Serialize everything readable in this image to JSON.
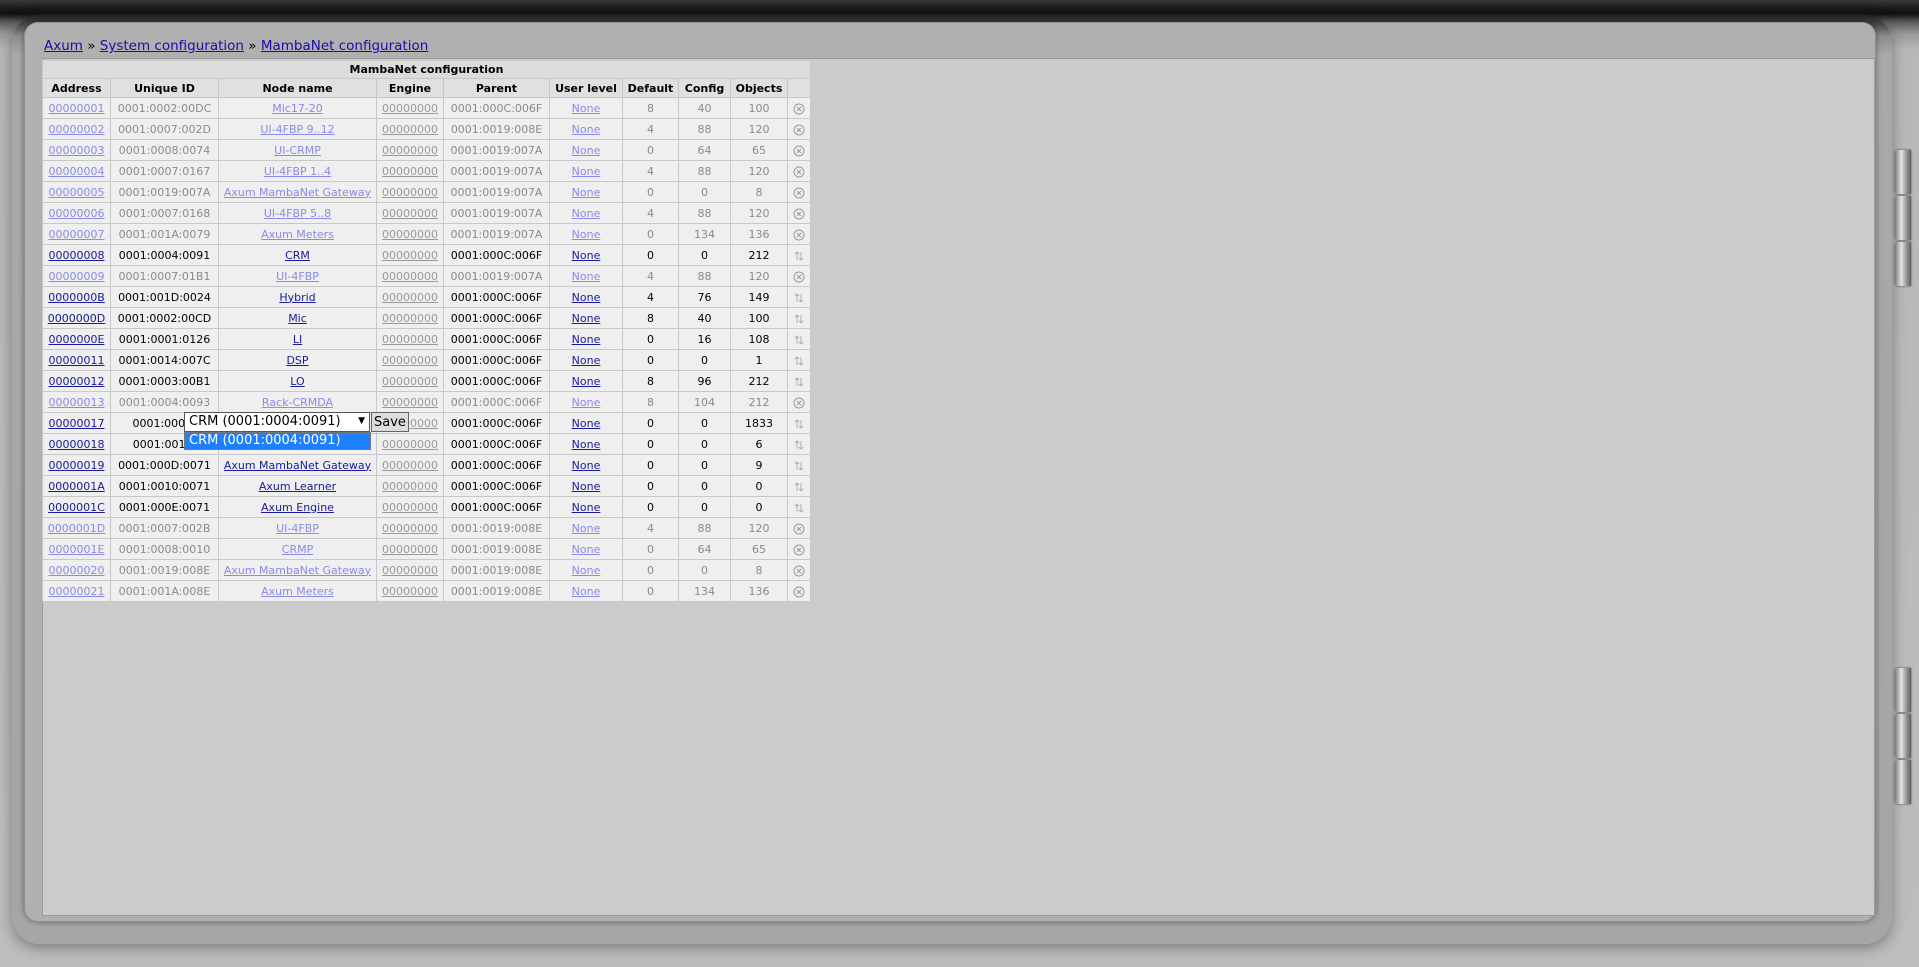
{
  "breadcrumb": {
    "home": "Axum",
    "sep1": "»",
    "system": "System configuration",
    "sep2": "»",
    "page": "MambaNet configuration"
  },
  "table": {
    "title": "MambaNet configuration",
    "columns": [
      "Address",
      "Unique ID",
      "Node name",
      "Engine",
      "Parent",
      "User level",
      "Default",
      "Config",
      "Objects",
      ""
    ],
    "rows": [
      {
        "address": "00000001",
        "uid": "0001:0002:00DC",
        "name": "Mic17-20",
        "engine": "00000000",
        "parent": "0001:000C:006F",
        "level": "None",
        "default": "8",
        "config": "40",
        "objects": "100",
        "state": "inactive"
      },
      {
        "address": "00000002",
        "uid": "0001:0007:002D",
        "name": "UI-4FBP 9..12",
        "engine": "00000000",
        "parent": "0001:0019:008E",
        "level": "None",
        "default": "4",
        "config": "88",
        "objects": "120",
        "state": "inactive"
      },
      {
        "address": "00000003",
        "uid": "0001:0008:0074",
        "name": "UI-CRMP",
        "engine": "00000000",
        "parent": "0001:0019:007A",
        "level": "None",
        "default": "0",
        "config": "64",
        "objects": "65",
        "state": "inactive"
      },
      {
        "address": "00000004",
        "uid": "0001:0007:0167",
        "name": "UI-4FBP 1..4",
        "engine": "00000000",
        "parent": "0001:0019:007A",
        "level": "None",
        "default": "4",
        "config": "88",
        "objects": "120",
        "state": "inactive"
      },
      {
        "address": "00000005",
        "uid": "0001:0019:007A",
        "name": "Axum MambaNet Gateway",
        "engine": "00000000",
        "parent": "0001:0019:007A",
        "level": "None",
        "default": "0",
        "config": "0",
        "objects": "8",
        "state": "inactive"
      },
      {
        "address": "00000006",
        "uid": "0001:0007:0168",
        "name": "UI-4FBP 5..8",
        "engine": "00000000",
        "parent": "0001:0019:007A",
        "level": "None",
        "default": "4",
        "config": "88",
        "objects": "120",
        "state": "inactive"
      },
      {
        "address": "00000007",
        "uid": "0001:001A:0079",
        "name": "Axum Meters",
        "engine": "00000000",
        "parent": "0001:0019:007A",
        "level": "None",
        "default": "0",
        "config": "134",
        "objects": "136",
        "state": "inactive"
      },
      {
        "address": "00000008",
        "uid": "0001:0004:0091",
        "name": "CRM",
        "engine": "00000000",
        "parent": "0001:000C:006F",
        "level": "None",
        "default": "0",
        "config": "0",
        "objects": "212",
        "state": "active"
      },
      {
        "address": "00000009",
        "uid": "0001:0007:01B1",
        "name": "UI-4FBP",
        "engine": "00000000",
        "parent": "0001:0019:007A",
        "level": "None",
        "default": "4",
        "config": "88",
        "objects": "120",
        "state": "inactive"
      },
      {
        "address": "0000000B",
        "uid": "0001:001D:0024",
        "name": "Hybrid",
        "engine": "00000000",
        "parent": "0001:000C:006F",
        "level": "None",
        "default": "4",
        "config": "76",
        "objects": "149",
        "state": "active"
      },
      {
        "address": "0000000D",
        "uid": "0001:0002:00CD",
        "name": "Mic",
        "engine": "00000000",
        "parent": "0001:000C:006F",
        "level": "None",
        "default": "8",
        "config": "40",
        "objects": "100",
        "state": "active"
      },
      {
        "address": "0000000E",
        "uid": "0001:0001:0126",
        "name": "LI",
        "engine": "00000000",
        "parent": "0001:000C:006F",
        "level": "None",
        "default": "0",
        "config": "16",
        "objects": "108",
        "state": "active"
      },
      {
        "address": "00000011",
        "uid": "0001:0014:007C",
        "name": "DSP",
        "engine": "00000000",
        "parent": "0001:000C:006F",
        "level": "None",
        "default": "0",
        "config": "0",
        "objects": "1",
        "state": "active"
      },
      {
        "address": "00000012",
        "uid": "0001:0003:00B1",
        "name": "LO",
        "engine": "00000000",
        "parent": "0001:000C:006F",
        "level": "None",
        "default": "8",
        "config": "96",
        "objects": "212",
        "state": "active"
      },
      {
        "address": "00000013",
        "uid": "0001:0004:0093",
        "name": "Rack-CRMDA",
        "engine": "00000000",
        "parent": "0001:000C:006F",
        "level": "None",
        "default": "8",
        "config": "104",
        "objects": "212",
        "state": "inactive"
      },
      {
        "address": "00000017",
        "uid": "0001:000C:",
        "name": "",
        "engine": "00000000",
        "parent": "0001:000C:006F",
        "level": "None",
        "default": "0",
        "config": "0",
        "objects": "1833",
        "state": "active"
      },
      {
        "address": "00000018",
        "uid": "0001:0016:",
        "name": "",
        "engine": "00000000",
        "parent": "0001:000C:006F",
        "level": "None",
        "default": "0",
        "config": "0",
        "objects": "6",
        "state": "active"
      },
      {
        "address": "00000019",
        "uid": "0001:000D:0071",
        "name": "Axum MambaNet Gateway",
        "engine": "00000000",
        "parent": "0001:000C:006F",
        "level": "None",
        "default": "0",
        "config": "0",
        "objects": "9",
        "state": "active"
      },
      {
        "address": "0000001A",
        "uid": "0001:0010:0071",
        "name": "Axum Learner",
        "engine": "00000000",
        "parent": "0001:000C:006F",
        "level": "None",
        "default": "0",
        "config": "0",
        "objects": "0",
        "state": "active"
      },
      {
        "address": "0000001C",
        "uid": "0001:000E:0071",
        "name": "Axum Engine",
        "engine": "00000000",
        "parent": "0001:000C:006F",
        "level": "None",
        "default": "0",
        "config": "0",
        "objects": "0",
        "state": "active"
      },
      {
        "address": "0000001D",
        "uid": "0001:0007:002B",
        "name": "UI-4FBP",
        "engine": "00000000",
        "parent": "0001:0019:008E",
        "level": "None",
        "default": "4",
        "config": "88",
        "objects": "120",
        "state": "inactive"
      },
      {
        "address": "0000001E",
        "uid": "0001:0008:0010",
        "name": "CRMP",
        "engine": "00000000",
        "parent": "0001:0019:008E",
        "level": "None",
        "default": "0",
        "config": "64",
        "objects": "65",
        "state": "inactive"
      },
      {
        "address": "00000020",
        "uid": "0001:0019:008E",
        "name": "Axum MambaNet Gateway",
        "engine": "00000000",
        "parent": "0001:0019:008E",
        "level": "None",
        "default": "0",
        "config": "0",
        "objects": "8",
        "state": "inactive"
      },
      {
        "address": "00000021",
        "uid": "0001:001A:008E",
        "name": "Axum Meters",
        "engine": "00000000",
        "parent": "0001:0019:008E",
        "level": "None",
        "default": "0",
        "config": "134",
        "objects": "136",
        "state": "inactive"
      }
    ]
  },
  "editor": {
    "selected": "CRM (0001:0004:0091)",
    "arrow": "▼",
    "save_label": "Save",
    "options": [
      "CRM (0001:0004:0091)"
    ]
  },
  "icons": {
    "inactive_row": "remove-circle-icon",
    "active_row": "refresh-icon"
  }
}
